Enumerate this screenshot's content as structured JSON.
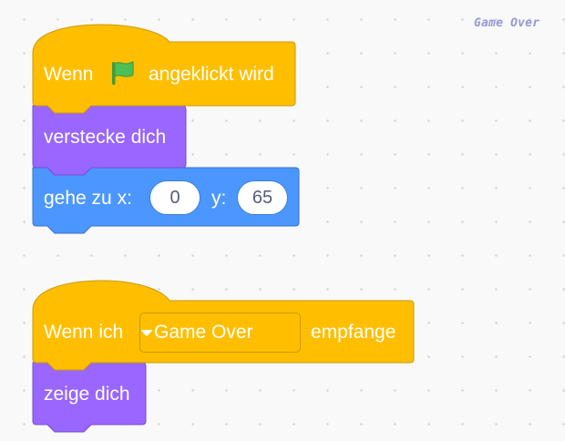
{
  "watermark": "Game Over",
  "script1": {
    "hat_prefix": "Wenn",
    "hat_suffix": "angeklickt wird",
    "hide_block": "verstecke dich",
    "goto_label_x": "gehe zu x:",
    "goto_label_y": "y:",
    "x_value": "0",
    "y_value": "65"
  },
  "script2": {
    "hat_prefix": "Wenn ich",
    "message_option": "Game Over",
    "hat_suffix": "empfange",
    "show_block": "zeige dich"
  },
  "colors": {
    "events": "#ffbf00",
    "events_border": "#cc9900",
    "looks": "#9966ff",
    "looks_border": "#774dcb",
    "motion": "#4c97ff",
    "motion_border": "#3373cc",
    "flag_green": "#4cbf56"
  },
  "icons": [
    "green-flag-icon",
    "dropdown-arrow-icon"
  ]
}
